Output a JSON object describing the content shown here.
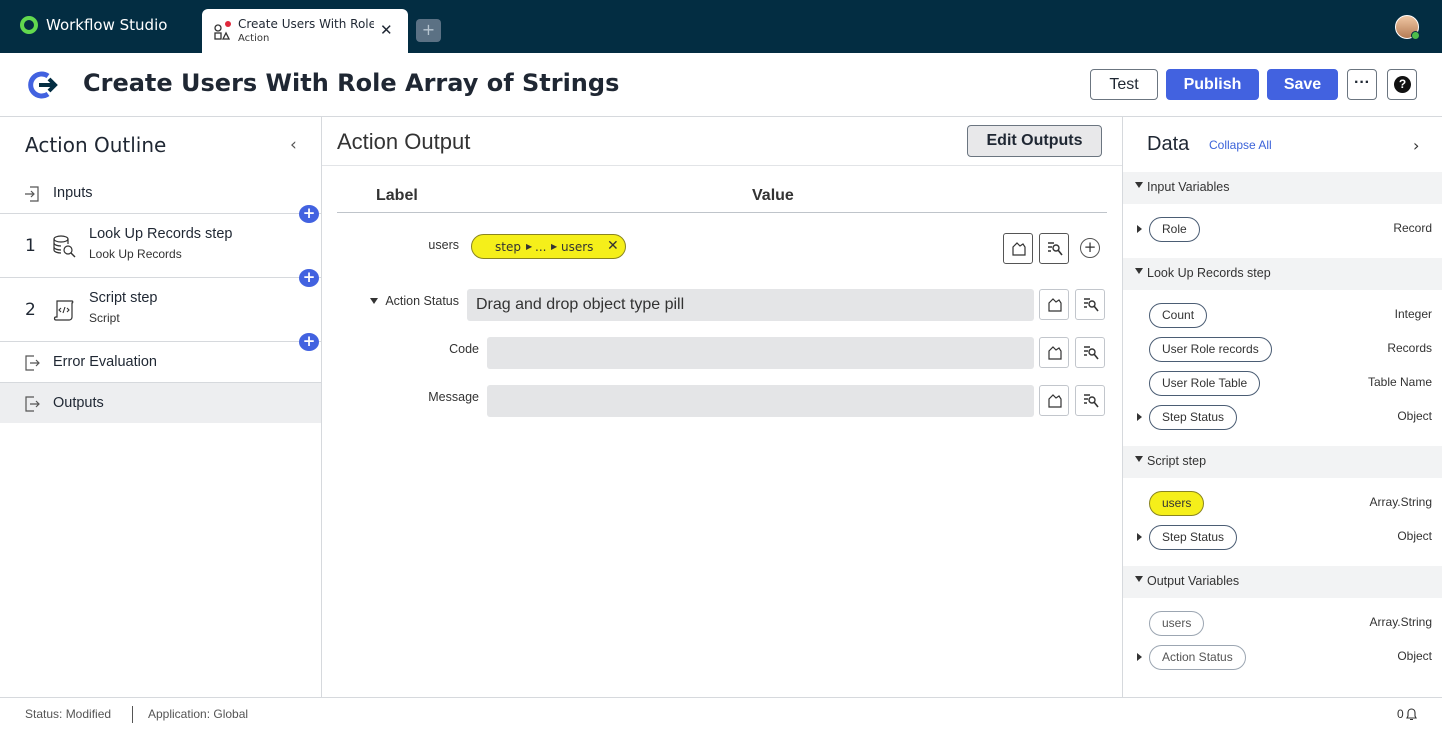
{
  "app": {
    "name": "Workflow Studio"
  },
  "tab": {
    "title": "Create Users With Role Array of Strings",
    "subtitle": "Action",
    "add": "+"
  },
  "header": {
    "title": "Create Users With Role Array of Strings",
    "buttons": {
      "test": "Test",
      "publish": "Publish",
      "save": "Save",
      "more": "···",
      "help": "?"
    }
  },
  "outline": {
    "title": "Action Outline",
    "inputs": "Inputs",
    "steps": [
      {
        "num": "1",
        "title": "Look Up Records step",
        "sub": "Look Up Records"
      },
      {
        "num": "2",
        "title": "Script step",
        "sub": "Script"
      }
    ],
    "error_evaluation": "Error Evaluation",
    "outputs": "Outputs",
    "add_symbol": "+"
  },
  "output": {
    "title": "Action Output",
    "edit_button": "Edit Outputs",
    "col_label": "Label",
    "col_value": "Value",
    "rows": {
      "users": {
        "label": "users",
        "pill": [
          "step",
          "...",
          "users"
        ]
      },
      "action_status": {
        "label": "Action Status",
        "placeholder": "Drag and drop object type pill"
      },
      "code": {
        "label": "Code"
      },
      "message": {
        "label": "Message"
      }
    }
  },
  "data_panel": {
    "title": "Data",
    "collapse_all": "Collapse All",
    "sections": {
      "input_variables": {
        "title": "Input Variables",
        "items": [
          {
            "label": "Role",
            "type": "Record"
          }
        ]
      },
      "lookup": {
        "title": "Look Up Records step",
        "items": [
          {
            "label": "Count",
            "type": "Integer"
          },
          {
            "label": "User Role records",
            "type": "Records"
          },
          {
            "label": "User Role Table",
            "type": "Table Name"
          },
          {
            "label": "Step Status",
            "type": "Object"
          }
        ]
      },
      "script": {
        "title": "Script step",
        "items": [
          {
            "label": "users",
            "type": "Array.String"
          },
          {
            "label": "Step Status",
            "type": "Object"
          }
        ]
      },
      "output_variables": {
        "title": "Output Variables",
        "items": [
          {
            "label": "users",
            "type": "Array.String"
          },
          {
            "label": "Action Status",
            "type": "Object"
          }
        ]
      }
    }
  },
  "status": {
    "state": "Status: Modified",
    "application": "Application: Global",
    "notifications": "0"
  },
  "colors": {
    "topbar": "#032d42",
    "primary": "#4262e0",
    "pill_yellow": "#f5ef1a",
    "brand_green": "#62d84e"
  }
}
